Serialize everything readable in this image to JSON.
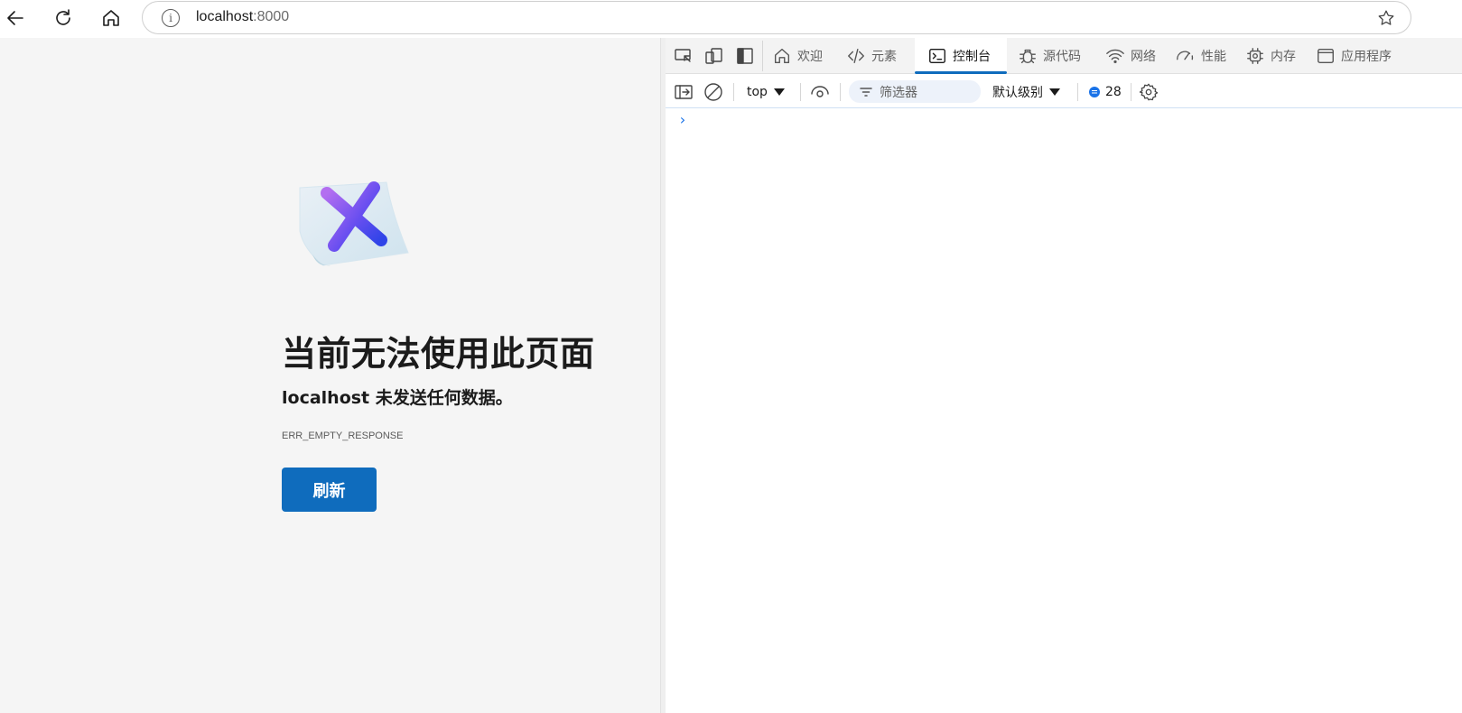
{
  "browser": {
    "url_host": "localhost",
    "url_port": ":8000"
  },
  "error_page": {
    "title": "当前无法使用此页面",
    "subtitle": "localhost 未发送任何数据。",
    "code": "ERR_EMPTY_RESPONSE",
    "refresh_label": "刷新"
  },
  "devtools": {
    "tabs": [
      {
        "label": "欢迎",
        "icon": "home-icon"
      },
      {
        "label": "元素",
        "icon": "code-icon"
      },
      {
        "label": "控制台",
        "icon": "console-icon",
        "active": true
      },
      {
        "label": "源代码",
        "icon": "bug-icon"
      },
      {
        "label": "网络",
        "icon": "wifi-icon"
      },
      {
        "label": "性能",
        "icon": "gauge-icon"
      },
      {
        "label": "内存",
        "icon": "chip-icon"
      },
      {
        "label": "应用程序",
        "icon": "app-window-icon"
      }
    ],
    "toolbar": {
      "context": "top",
      "filter_placeholder": "筛选器",
      "level": "默认级别",
      "issues_count": "28"
    },
    "prompt": "›"
  },
  "colors": {
    "accent": "#0f6cbd",
    "page_bg": "#f5f5f5"
  }
}
